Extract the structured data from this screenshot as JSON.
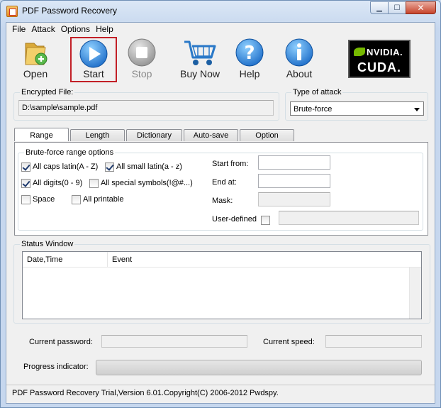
{
  "window": {
    "title": "PDF Password Recovery"
  },
  "menu": [
    "File",
    "Attack",
    "Options",
    "Help"
  ],
  "toolbar": {
    "open": "Open",
    "start": "Start",
    "stop": "Stop",
    "buy_now": "Buy Now",
    "help": "Help",
    "about": "About",
    "nvidia_brand": "NVIDIA.",
    "nvidia_cuda": "CUDA."
  },
  "encrypted_file": {
    "label": "Encrypted File:",
    "value": "D:\\sample\\sample.pdf"
  },
  "attack_type": {
    "label": "Type of attack",
    "value": "Brute-force"
  },
  "tabs": [
    "Range",
    "Length",
    "Dictionary",
    "Auto-save",
    "Option"
  ],
  "range": {
    "group_label": "Brute-force range options",
    "caps": {
      "label": "All caps latin(A - Z)",
      "checked": true
    },
    "small": {
      "label": "All small latin(a - z)",
      "checked": true
    },
    "digits": {
      "label": "All digits(0 - 9)",
      "checked": true
    },
    "special": {
      "label": "All special symbols(!@#...)",
      "checked": false
    },
    "space": {
      "label": "Space",
      "checked": false
    },
    "printable": {
      "label": "All printable",
      "checked": false
    },
    "start_from": {
      "label": "Start from:",
      "value": ""
    },
    "end_at": {
      "label": "End at:",
      "value": ""
    },
    "mask": {
      "label": "Mask:",
      "value": ""
    },
    "user_defined": {
      "label": "User-defined",
      "checked": false,
      "value": ""
    }
  },
  "status_window": {
    "label": "Status Window",
    "columns": [
      "Date,Time",
      "Event"
    ]
  },
  "current_password_label": "Current password:",
  "current_speed_label": "Current speed:",
  "progress_label": "Progress indicator:",
  "progress_value": 0,
  "statusbar": "PDF Password Recovery Trial,Version 6.01.Copyright(C) 2006-2012 Pwdspy.",
  "colors": {
    "selected_outline": "#c21f26",
    "nvidia_green": "#76b900"
  }
}
